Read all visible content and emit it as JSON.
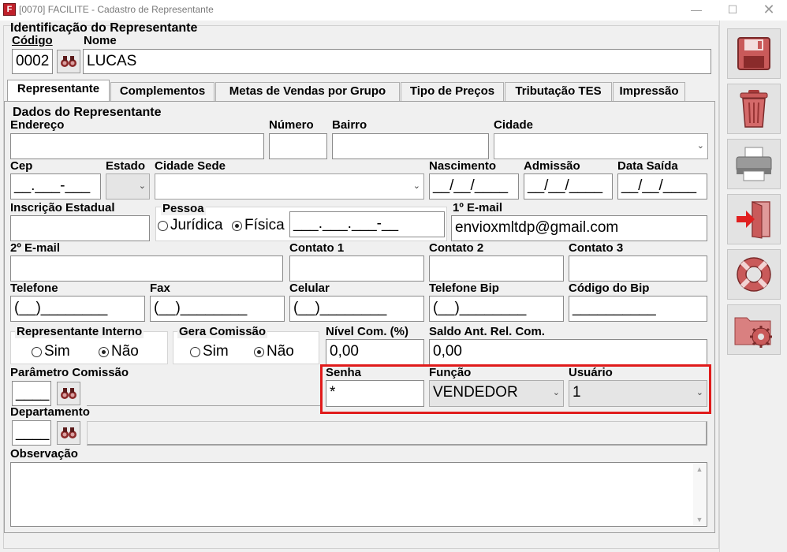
{
  "window": {
    "title": "[0070] FACILITE - Cadastro de Representante",
    "app_icon_letter": "F"
  },
  "header": {
    "section_title": "Identificação do Representante",
    "codigo_label": "Código",
    "codigo_value": "0002",
    "nome_label": "Nome",
    "nome_value": "LUCAS"
  },
  "tabs": [
    {
      "label": "Representante"
    },
    {
      "label": "Complementos"
    },
    {
      "label": "Metas de Vendas por Grupo"
    },
    {
      "label": "Tipo de Preços"
    },
    {
      "label": "Tributação TES"
    },
    {
      "label": "Impressão"
    }
  ],
  "form": {
    "group_title": "Dados do Representante",
    "endereco_label": "Endereço",
    "endereco_value": "",
    "numero_label": "Número",
    "numero_value": "",
    "bairro_label": "Bairro",
    "bairro_value": "",
    "cidade_label": "Cidade",
    "cidade_value": "",
    "cep_label": "Cep",
    "cep_value": "__.___-___",
    "estado_label": "Estado",
    "estado_value": "",
    "cidade_sede_label": "Cidade Sede",
    "cidade_sede_value": "",
    "nascimento_label": "Nascimento",
    "nascimento_value": "__/__/____",
    "admissao_label": "Admissão",
    "admissao_value": "__/__/____",
    "data_saida_label": "Data Saída",
    "data_saida_value": "__/__/____",
    "inscricao_label": "Inscrição Estadual",
    "inscricao_value": "",
    "pessoa_label": "Pessoa",
    "pessoa_juridica": "Jurídica",
    "pessoa_fisica": "Física",
    "cpf_value": "___.___.___-__",
    "email1_label": "1º E-mail",
    "email1_value": "envioxmltdp@gmail.com",
    "email2_label": "2º E-mail",
    "email2_value": "",
    "contato1_label": "Contato 1",
    "contato1_value": "",
    "contato2_label": "Contato 2",
    "contato2_value": "",
    "contato3_label": "Contato 3",
    "contato3_value": "",
    "telefone_label": "Telefone",
    "telefone_value": "(__)________",
    "fax_label": "Fax",
    "fax_value": "(__)________",
    "celular_label": "Celular",
    "celular_value": "(__)________",
    "telefone_bip_label": "Telefone Bip",
    "telefone_bip_value": "(__)________",
    "codigo_bip_label": "Código do Bip",
    "codigo_bip_value": "__________",
    "rep_interno_label": "Representante Interno",
    "gera_comissao_label": "Gera Comissão",
    "sim_label": "Sim",
    "nao_label": "Não",
    "nivel_com_label": "Nível Com. (%)",
    "nivel_com_value": "0,00",
    "saldo_ant_label": "Saldo Ant. Rel. Com.",
    "saldo_ant_value": "0,00",
    "parametro_label": "Parâmetro Comissão",
    "parametro_value": "____",
    "senha_label": "Senha",
    "senha_value": "*",
    "funcao_label": "Função",
    "funcao_value": "VENDEDOR",
    "usuario_label": "Usuário",
    "usuario_value": "1",
    "departamento_label": "Departamento",
    "departamento_value": "____",
    "observacao_label": "Observação",
    "observacao_value": ""
  },
  "toolbar": [
    {
      "icon": "floppy-save-icon"
    },
    {
      "icon": "trash-icon"
    },
    {
      "icon": "printer-icon"
    },
    {
      "icon": "exit-door-icon"
    },
    {
      "icon": "lifebuoy-help-icon"
    },
    {
      "icon": "folder-settings-icon"
    }
  ],
  "colors": {
    "highlight": "#e01b1b",
    "icon_red": "#c94a4a"
  }
}
